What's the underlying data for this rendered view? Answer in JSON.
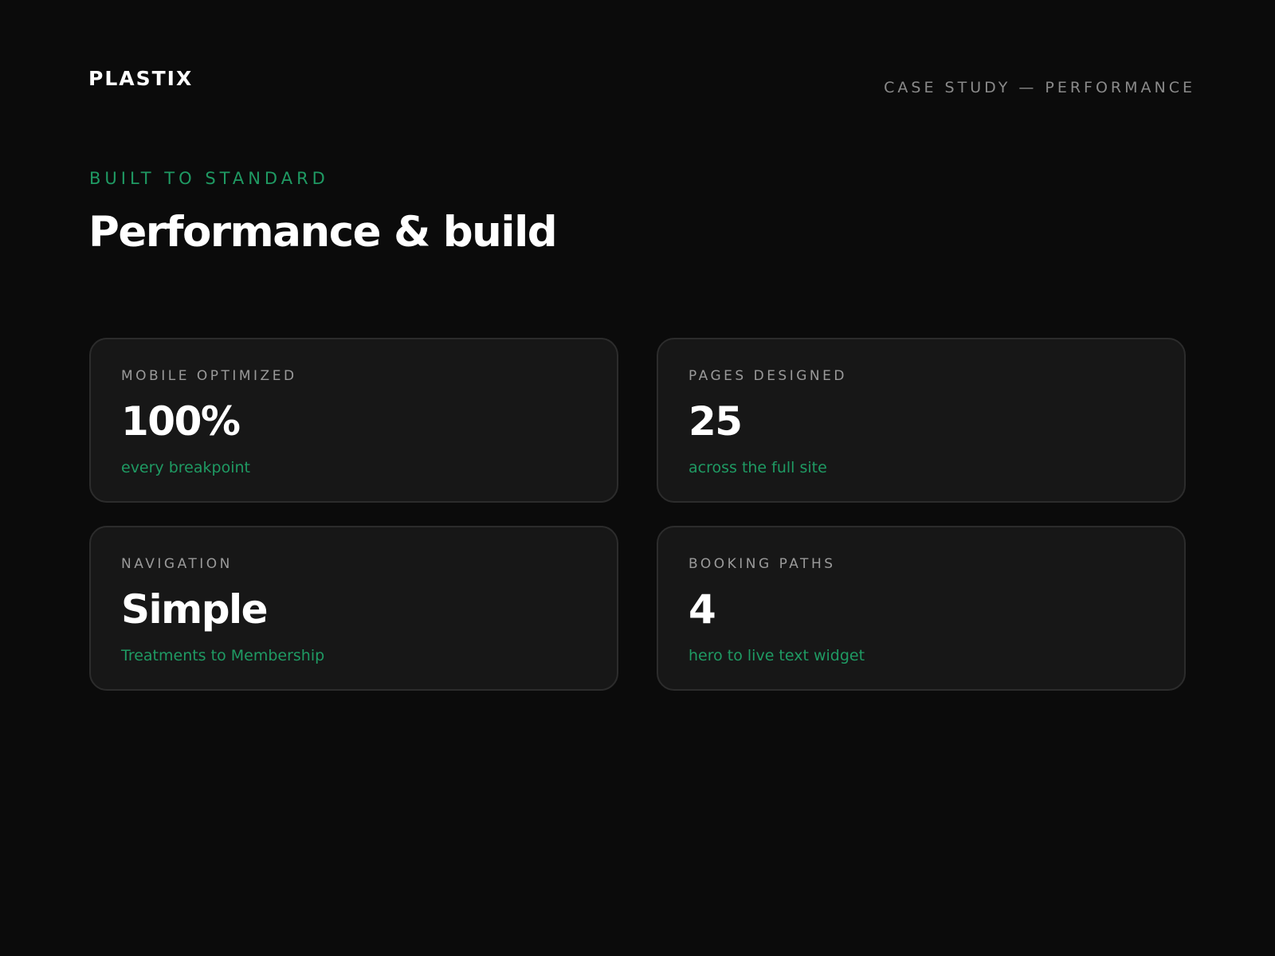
{
  "header": {
    "logo": "PLASTIX",
    "section_label": "CASE STUDY — PERFORMANCE"
  },
  "intro": {
    "eyebrow": "BUILT TO STANDARD",
    "title": "Performance & build"
  },
  "stats": [
    {
      "label": "MOBILE OPTIMIZED",
      "value": "100%",
      "note": "every breakpoint"
    },
    {
      "label": "PAGES DESIGNED",
      "value": "25",
      "note": "across the full site"
    },
    {
      "label": "NAVIGATION",
      "value": "Simple",
      "note": "Treatments to Membership"
    },
    {
      "label": "BOOKING PATHS",
      "value": "4",
      "note": "hero to live text widget"
    }
  ],
  "colors": {
    "background": "#0b0b0b",
    "card_background": "#171717",
    "card_border": "#2c2c2c",
    "accent": "#1f9a63",
    "muted_text": "#8a8a8a",
    "primary_text": "#ffffff"
  }
}
